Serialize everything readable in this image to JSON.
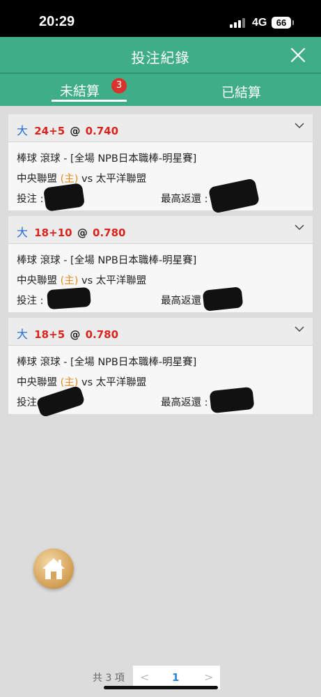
{
  "status_bar": {
    "time": "20:29",
    "network": "4G",
    "battery": "66"
  },
  "header": {
    "title": "投注紀錄"
  },
  "tabs": [
    {
      "label": "未結算",
      "badge": "3"
    },
    {
      "label": "已結算"
    }
  ],
  "bets": [
    {
      "type": "大",
      "line": "24+5",
      "at": "@",
      "odds": "0.740",
      "match_info": "棒球 滾球 - [全場 NPB日本職棒-明星賽]",
      "home_team": "中央聯盟",
      "home_tag": "(主)",
      "vs": "vs",
      "away_team": "太平洋聯盟",
      "stake_label": "投注 :",
      "return_label": "最高返還 :"
    },
    {
      "type": "大",
      "line": "18+10",
      "at": "@",
      "odds": "0.780",
      "match_info": "棒球 滾球 - [全場 NPB日本職棒-明星賽]",
      "home_team": "中央聯盟",
      "home_tag": "(主)",
      "vs": "vs",
      "away_team": "太平洋聯盟",
      "stake_label": "投注 :",
      "return_label": "最高返還 :"
    },
    {
      "type": "大",
      "line": "18+5",
      "at": "@",
      "odds": "0.780",
      "match_info": "棒球 滾球 - [全場 NPB日本職棒-明星賽]",
      "home_team": "中央聯盟",
      "home_tag": "(主)",
      "vs": "vs",
      "away_team": "太平洋聯盟",
      "stake_label": "投注 :",
      "return_label": "最高返還 :"
    }
  ],
  "pagination": {
    "total": "共 3 項",
    "prev": "<",
    "current_page": "1",
    "next": ">"
  },
  "colors": {
    "header": "#3fae88",
    "badge": "#d9312b",
    "bet_type": "#1f6fd6",
    "odds": "#d9241d",
    "home_tag": "#e48a1c",
    "page": "#2b86d9"
  }
}
